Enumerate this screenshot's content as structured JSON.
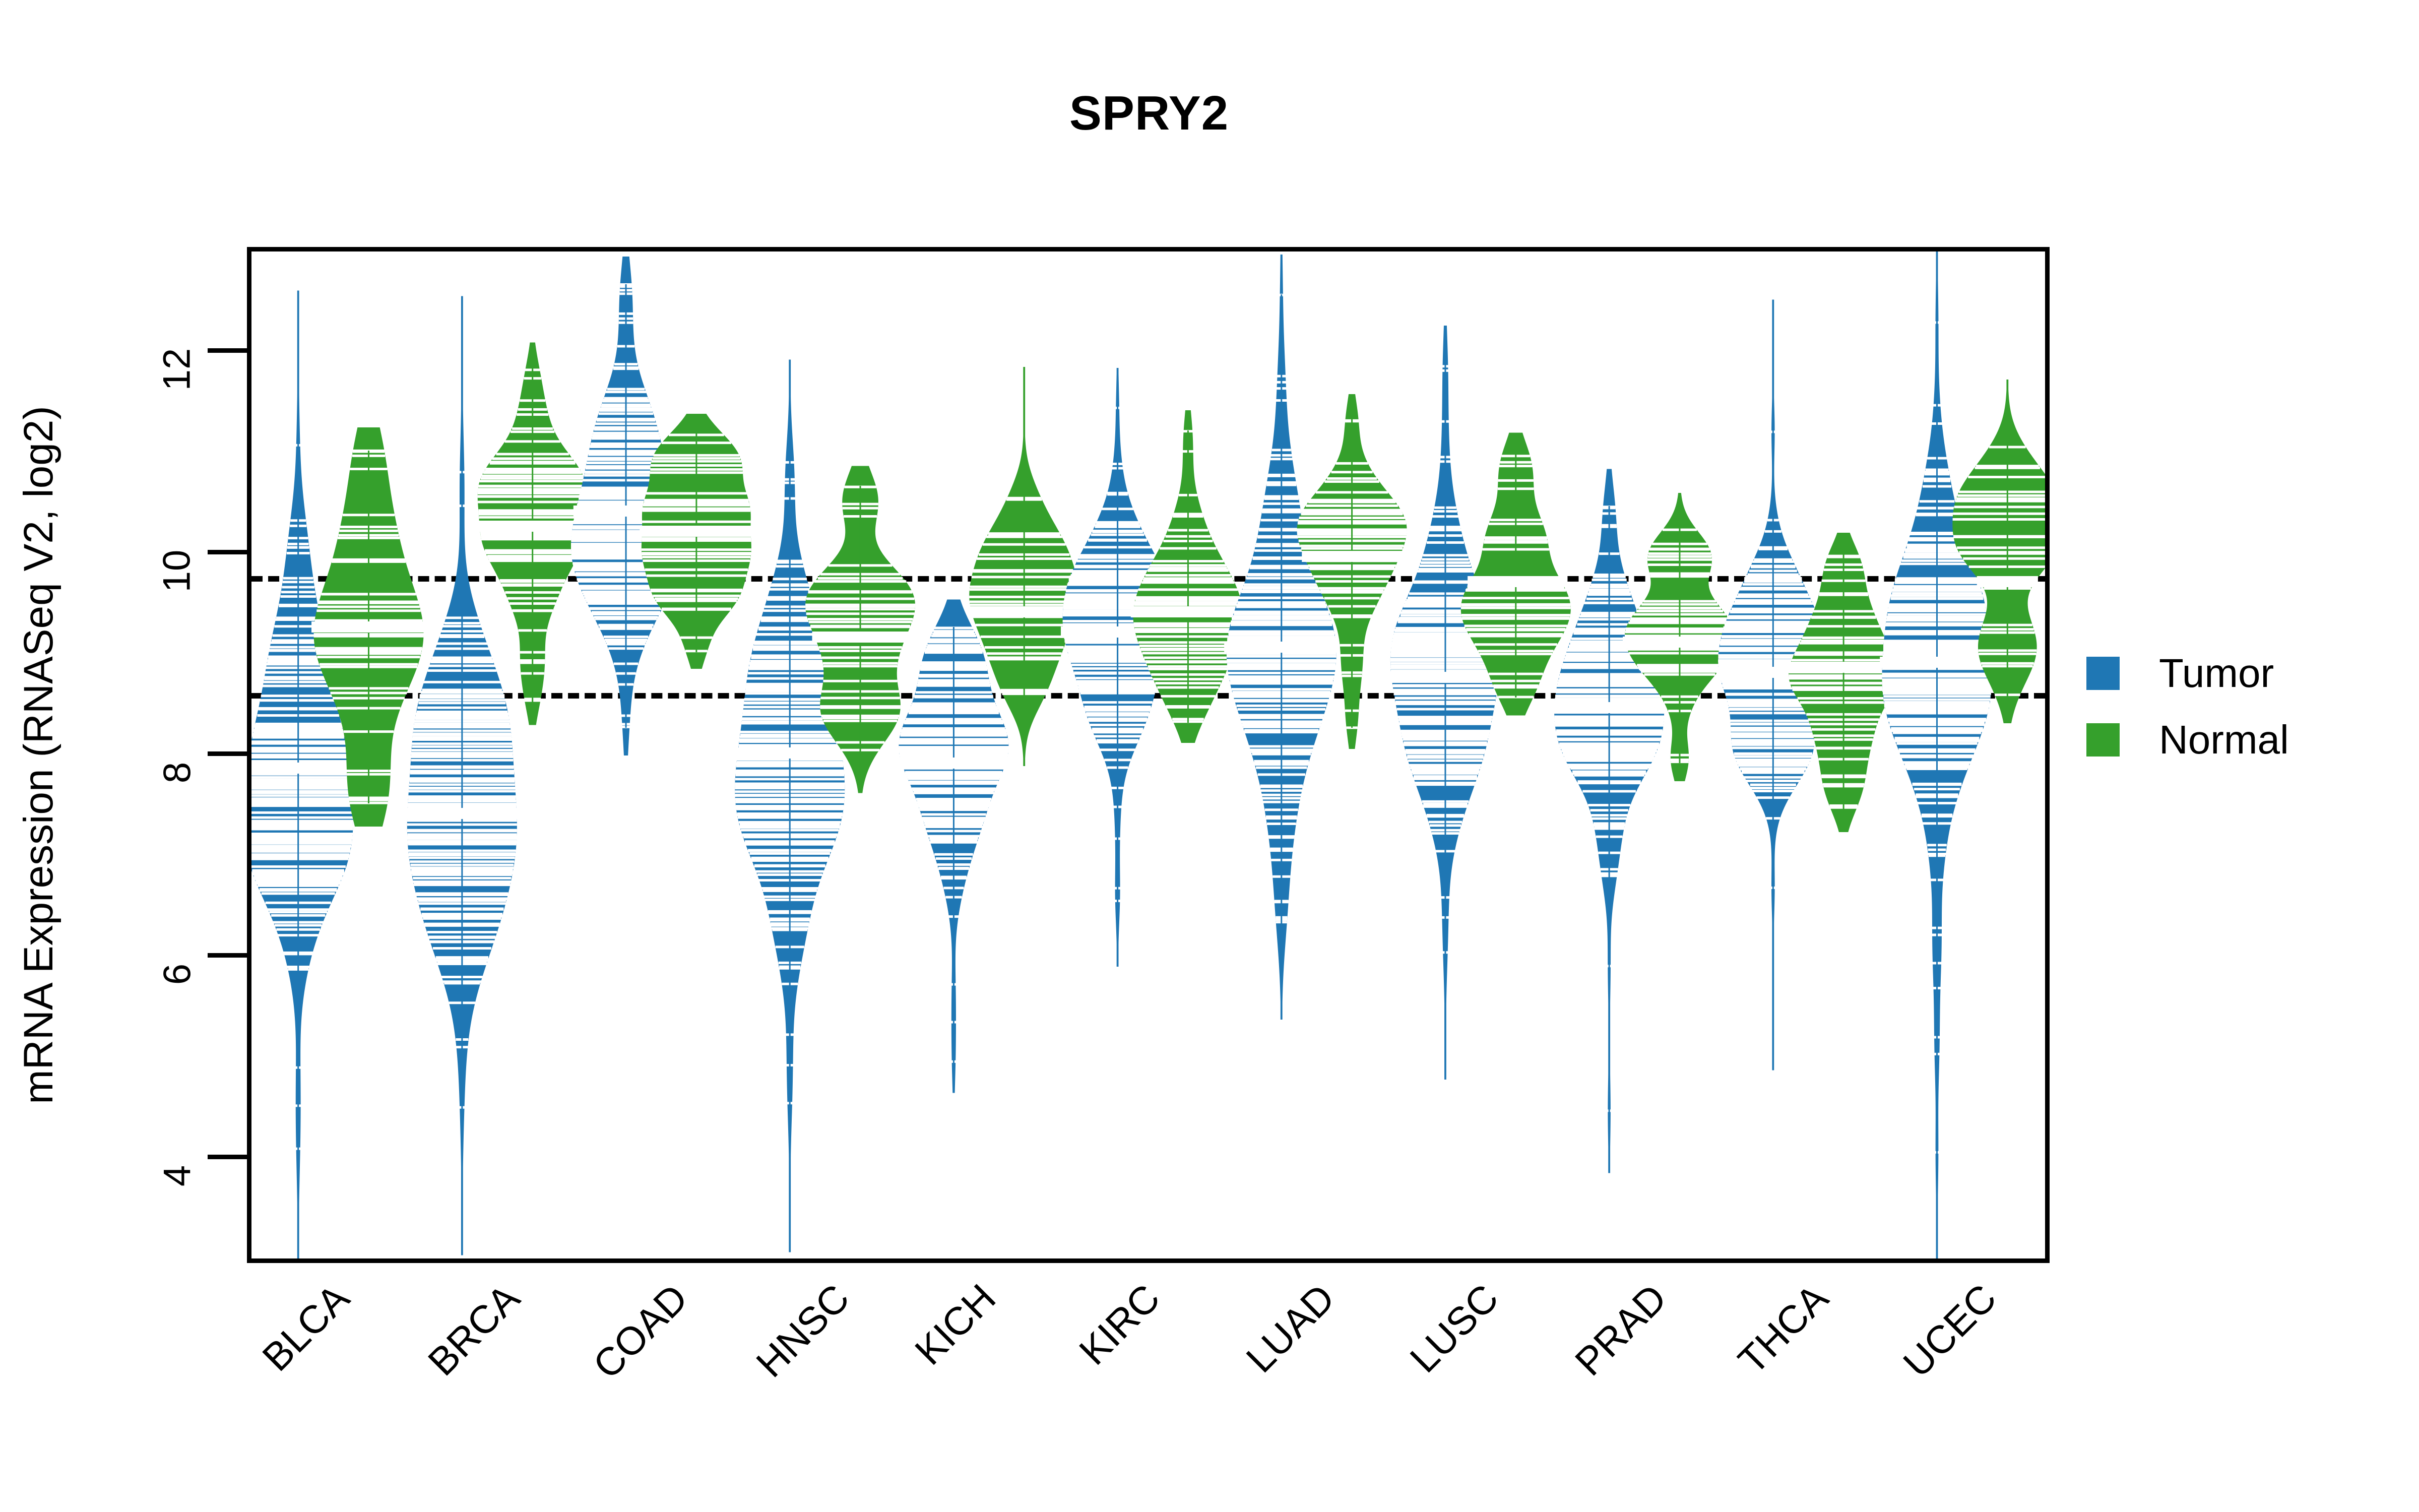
{
  "title": "SPRY2",
  "axes": {
    "y_label": "mRNA Expression (RNASeq V2, log2)",
    "y_ticks": [
      "4",
      "6",
      "8",
      "10",
      "12"
    ],
    "y_tick_values": [
      4,
      6,
      8,
      10,
      12
    ],
    "y_min": 2.2,
    "y_max": 13.3,
    "x_label": ""
  },
  "legend": {
    "position": "right",
    "items": [
      {
        "label": "Tumor",
        "color": "#1f77b4"
      },
      {
        "label": "Normal",
        "color": "#35a02c"
      }
    ]
  },
  "colors": {
    "tumor": "#1f77b4",
    "normal": "#35a02c",
    "frame": "#000000",
    "reference_line": "#000000",
    "background": "#ffffff"
  },
  "reference_lines": [
    9.76,
    8.6
  ],
  "chart_data": {
    "type": "violin",
    "title": "SPRY2",
    "xlabel": "",
    "ylabel": "mRNA Expression (RNASeq V2, log2)",
    "ylim": [
      2.2,
      13.3
    ],
    "grid": false,
    "legend_position": "right",
    "annotations": [
      {
        "type": "hline",
        "value": 9.76,
        "style": "dashed"
      },
      {
        "type": "hline",
        "value": 8.6,
        "style": "dashed"
      }
    ],
    "categories": [
      "BLCA",
      "BRCA",
      "COAD",
      "HNSC",
      "KICH",
      "KIRC",
      "LUAD",
      "LUSC",
      "PRAD",
      "THCA",
      "UCEC"
    ],
    "series": [
      {
        "name": "Tumor",
        "color": "#1f77b4",
        "stats": [
          {
            "category": "BLCA",
            "median": 7.9,
            "q1": 7.25,
            "q3": 8.6,
            "min": 3.5,
            "max": 12.15
          },
          {
            "category": "BRCA",
            "median": 7.45,
            "q1": 6.95,
            "q3": 8.35,
            "min": 3.55,
            "max": 12.1
          },
          {
            "category": "COAD",
            "median": 10.45,
            "q1": 9.95,
            "q3": 11.05,
            "min": 8.3,
            "max": 12.7
          },
          {
            "category": "HNSC",
            "median": 8.05,
            "q1": 7.45,
            "q3": 8.65,
            "min": 3.55,
            "max": 11.5
          },
          {
            "category": "KICH",
            "median": 7.95,
            "q1": 7.5,
            "q3": 8.4,
            "min": 4.95,
            "max": 9.3
          },
          {
            "category": "KIRC",
            "median": 9.25,
            "q1": 8.8,
            "q3": 9.7,
            "min": 6.25,
            "max": 11.55
          },
          {
            "category": "LUAD",
            "median": 9.1,
            "q1": 8.4,
            "q3": 9.75,
            "min": 5.8,
            "max": 12.6
          },
          {
            "category": "LUSC",
            "median": 8.8,
            "q1": 8.2,
            "q3": 9.4,
            "min": 5.2,
            "max": 11.9
          },
          {
            "category": "PRAD",
            "median": 8.5,
            "q1": 8.05,
            "q3": 9.05,
            "min": 4.25,
            "max": 10.5
          },
          {
            "category": "THCA",
            "median": 8.85,
            "q1": 8.45,
            "q3": 9.25,
            "min": 5.3,
            "max": 12.15
          },
          {
            "category": "UCEC",
            "median": 8.95,
            "q1": 8.4,
            "q3": 9.55,
            "min": 2.75,
            "max": 12.8
          }
        ]
      },
      {
        "name": "Normal",
        "color": "#35a02c",
        "stats": [
          {
            "category": "BLCA",
            "median": 9.3,
            "q1": 8.55,
            "q3": 9.9,
            "min": 7.55,
            "max": 11.05
          },
          {
            "category": "BRCA",
            "median": 10.3,
            "q1": 9.95,
            "q3": 10.7,
            "min": 8.55,
            "max": 11.9
          },
          {
            "category": "COAD",
            "median": 10.25,
            "q1": 9.95,
            "q3": 10.6,
            "min": 9.05,
            "max": 11.25
          },
          {
            "category": "HNSC",
            "median": 9.2,
            "q1": 8.8,
            "q3": 9.6,
            "min": 7.85,
            "max": 10.7
          },
          {
            "category": "KICH",
            "median": 9.45,
            "q1": 9.05,
            "q3": 9.85,
            "min": 8.15,
            "max": 11.65
          },
          {
            "category": "KIRC",
            "median": 9.45,
            "q1": 9.05,
            "q3": 9.9,
            "min": 8.35,
            "max": 11.25
          },
          {
            "category": "LUAD",
            "median": 10.0,
            "q1": 9.65,
            "q3": 10.4,
            "min": 8.3,
            "max": 11.4
          },
          {
            "category": "LUSC",
            "median": 9.75,
            "q1": 9.35,
            "q3": 10.15,
            "min": 8.6,
            "max": 11.05
          },
          {
            "category": "PRAD",
            "median": 9.15,
            "q1": 8.85,
            "q3": 9.5,
            "min": 7.95,
            "max": 10.45
          },
          {
            "category": "THCA",
            "median": 8.9,
            "q1": 8.55,
            "q3": 9.25,
            "min": 7.45,
            "max": 10.05
          },
          {
            "category": "UCEC",
            "median": 9.75,
            "q1": 9.35,
            "q3": 10.15,
            "min": 8.55,
            "max": 11.55
          }
        ]
      }
    ]
  }
}
